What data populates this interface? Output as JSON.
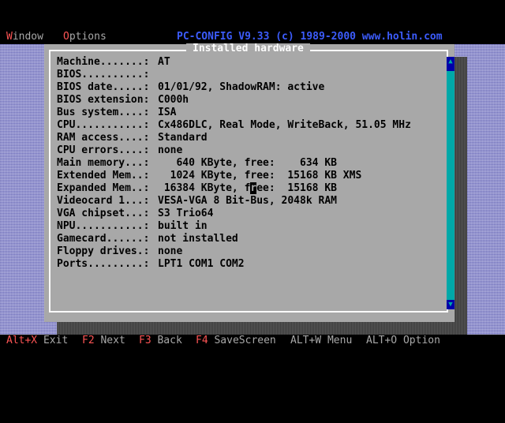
{
  "menubar": {
    "window": {
      "hot": "W",
      "rest": "indow"
    },
    "options": {
      "hot": "O",
      "rest": "ptions"
    },
    "app_title": "PC-CONFIG V9.33 (c) 1989-2000 www.holin.com"
  },
  "window": {
    "title": "Installed hardware",
    "rows": [
      {
        "label": "Machine.......:",
        "value": "AT"
      },
      {
        "label": "BIOS..........:",
        "value": ""
      },
      {
        "label": "BIOS date.....:",
        "value": "01/01/92, ShadowRAM: active"
      },
      {
        "label": "BIOS extension:",
        "value": "C000h"
      },
      {
        "label": "Bus system....:",
        "value": "ISA"
      },
      {
        "label": "CPU...........:",
        "value": "Cx486DLC, Real Mode, WriteBack, 51.05 MHz"
      },
      {
        "label": "RAM access....:",
        "value": "Standard"
      },
      {
        "label": "CPU errors....:",
        "value": "none"
      },
      {
        "label": "Main memory...:",
        "value": "   640 KByte, free:    634 KB"
      },
      {
        "label": "Extended Mem..:",
        "value": "  1024 KByte, free:  15168 KB XMS"
      },
      {
        "label": "Expanded Mem..:",
        "value_pre": " 16384 KByte, f",
        "value_cursor": "r",
        "value_post": "ee:  15168 KB"
      },
      {
        "label": "Videocard 1...:",
        "value": "VESA-VGA 8 Bit-Bus, 2048k RAM"
      },
      {
        "label": "VGA chipset...:",
        "value": "S3 Trio64"
      },
      {
        "label": "NPU...........:",
        "value": "built in"
      },
      {
        "label": "Gamecard......:",
        "value": "not installed"
      },
      {
        "label": "Floppy drives.:",
        "value": "none"
      },
      {
        "label": "Ports.........:",
        "value": "LPT1 COM1 COM2"
      }
    ]
  },
  "statusbar": {
    "items": [
      {
        "key": "Alt+X",
        "label": " Exit"
      },
      {
        "key": "F2",
        "label": " Next"
      },
      {
        "key": "F3",
        "label": " Back"
      },
      {
        "key": "F4",
        "label": " SaveScreen"
      },
      {
        "key": "",
        "label": "ALT+W Menu"
      },
      {
        "key": "",
        "label": "ALT+O Option"
      }
    ]
  },
  "colors": {
    "hotkey": "#fc5454",
    "title": "#3c5cfc",
    "window_bg": "#a8a8a8",
    "desktop": "#8c8cd0",
    "scrollbar": "#00a8a8"
  }
}
